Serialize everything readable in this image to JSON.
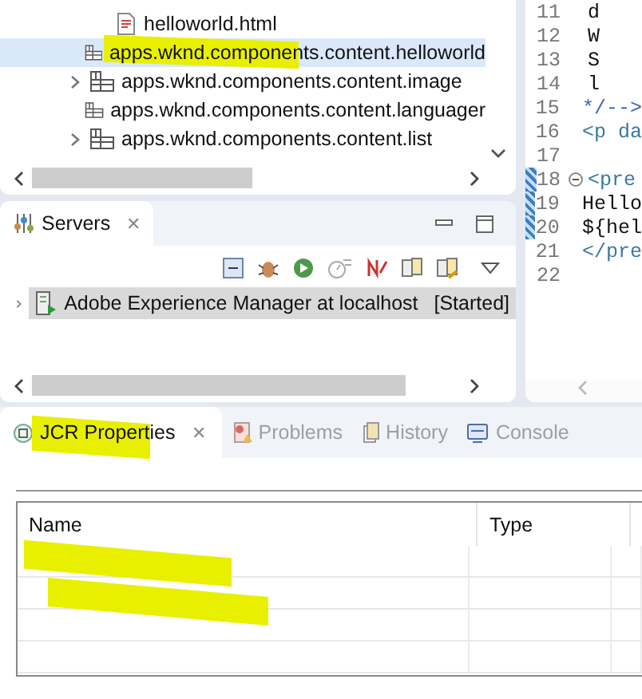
{
  "tree": {
    "items": [
      {
        "label": "helloworld.html",
        "kind": "file",
        "expandable": false,
        "selected": false,
        "highlighted": false
      },
      {
        "label": "apps.wknd.components.content.helloworld",
        "kind": "package",
        "expandable": false,
        "selected": true,
        "highlighted": true
      },
      {
        "label": "apps.wknd.components.content.image",
        "kind": "package",
        "expandable": true,
        "selected": false,
        "highlighted": false
      },
      {
        "label": "apps.wknd.components.content.languager",
        "kind": "package",
        "expandable": false,
        "selected": false,
        "highlighted": false
      },
      {
        "label": "apps.wknd.components.content.list",
        "kind": "package",
        "expandable": true,
        "selected": false,
        "highlighted": false
      }
    ]
  },
  "editor": {
    "lines": [
      {
        "number": "11",
        "code": "d",
        "kind": "text",
        "marked": false
      },
      {
        "number": "12",
        "code": "W",
        "kind": "text",
        "marked": false
      },
      {
        "number": "13",
        "code": "S",
        "kind": "text",
        "marked": false
      },
      {
        "number": "14",
        "code": "l",
        "kind": "text",
        "marked": false
      },
      {
        "number": "15",
        "code": "*/-->",
        "kind": "comment",
        "marked": false
      },
      {
        "number": "16",
        "code": "<p da",
        "kind": "tag",
        "marked": false
      },
      {
        "number": "17",
        "marked": false
      },
      {
        "number": "18",
        "code": "<pre",
        "kind": "tag",
        "folded": false,
        "marked": true
      },
      {
        "number": "19",
        "code": "Hello",
        "kind": "text",
        "marked": true
      },
      {
        "number": "20",
        "code": "${hel",
        "kind": "text",
        "marked": true
      },
      {
        "number": "21",
        "code": "</pre",
        "kind": "tag",
        "marked": false
      },
      {
        "number": "22",
        "marked": false
      }
    ]
  },
  "servers": {
    "title": "Servers",
    "close": "✕",
    "servers": [
      {
        "name": "Adobe Experience Manager at localhost",
        "status": "[Started]",
        "selected": true
      }
    ]
  },
  "bottom": {
    "tabs": [
      {
        "label": "JCR Properties",
        "selected": true,
        "close": "✕",
        "highlighted": true
      },
      {
        "label": "Problems",
        "selected": false
      },
      {
        "label": "History",
        "selected": false
      },
      {
        "label": "Console",
        "selected": false
      }
    ],
    "table": {
      "columns": [
        "Name",
        "Type"
      ],
      "rows": [
        {
          "redacted": true
        },
        {
          "redacted": true
        },
        {
          "redacted": false
        },
        {
          "redacted": false
        }
      ]
    }
  }
}
